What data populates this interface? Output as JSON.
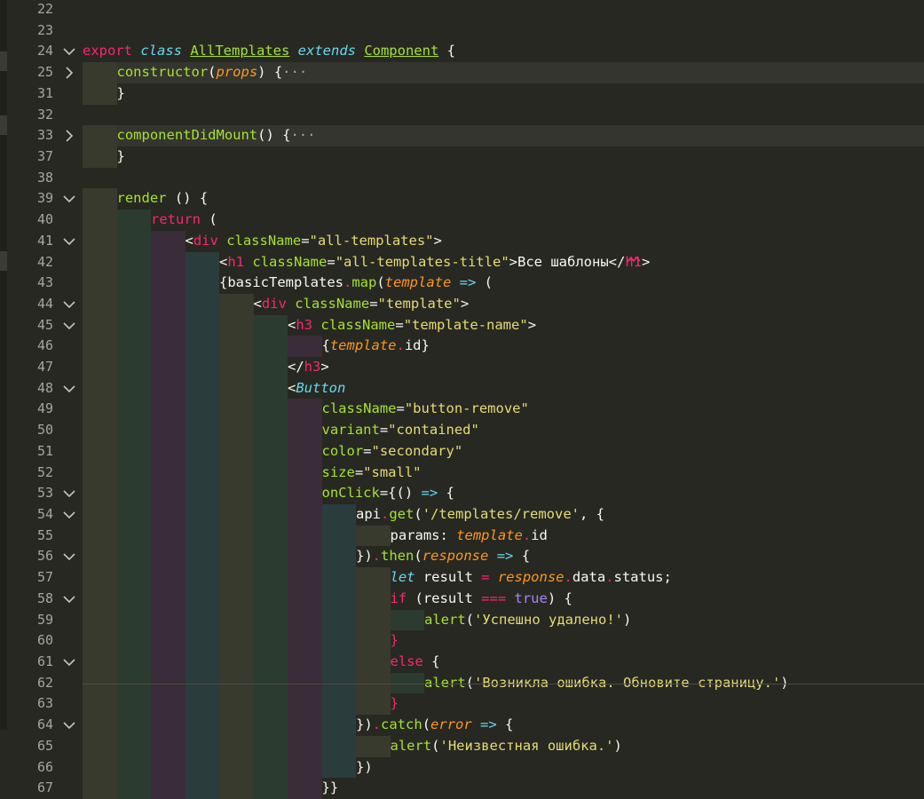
{
  "editor": {
    "colors": {
      "background": "#272822",
      "keyword": "#f92672",
      "storage": "#66d9ef",
      "class_name": "#a6e22e",
      "function": "#a6e22e",
      "string": "#e6db74",
      "parameter": "#fd971f",
      "attribute": "#a6e22e",
      "tag": "#f92672",
      "boolean": "#ae81ff",
      "plain": "#f8f8f2",
      "line_number": "#a6a69e"
    },
    "band_colors": [
      "#393a2e",
      "#2c3b30",
      "#3a2c38",
      "#2b3c3c"
    ],
    "lines": [
      {
        "n": "22",
        "fold": "",
        "depth": 0,
        "tokens": []
      },
      {
        "n": "23",
        "fold": "",
        "depth": 0,
        "tokens": []
      },
      {
        "n": "24",
        "fold": "open",
        "depth": 0,
        "tokens": [
          {
            "t": "export ",
            "c": "keyword"
          },
          {
            "t": "class ",
            "c": "storage",
            "i": true
          },
          {
            "t": "AllTemplates",
            "c": "class_name",
            "u": true
          },
          {
            "t": " "
          },
          {
            "t": "extends ",
            "c": "storage",
            "i": true
          },
          {
            "t": "Component",
            "c": "class_name",
            "u": true
          },
          {
            "t": " {"
          }
        ]
      },
      {
        "n": "25",
        "fold": "closed",
        "depth": 1,
        "hl": true,
        "tokens": [
          {
            "t": "constructor",
            "c": "function"
          },
          {
            "t": "("
          },
          {
            "t": "props",
            "c": "parameter",
            "i": true
          },
          {
            "t": ") {"
          },
          {
            "t": "···",
            "c": "line_number"
          }
        ]
      },
      {
        "n": "31",
        "fold": "",
        "depth": 1,
        "tokens": [
          {
            "t": "}"
          }
        ]
      },
      {
        "n": "32",
        "fold": "",
        "depth": 0,
        "tokens": []
      },
      {
        "n": "33",
        "fold": "closed",
        "depth": 1,
        "hl": true,
        "tokens": [
          {
            "t": "componentDidMount",
            "c": "function"
          },
          {
            "t": "() {"
          },
          {
            "t": "···",
            "c": "line_number"
          }
        ]
      },
      {
        "n": "37",
        "fold": "",
        "depth": 1,
        "tokens": [
          {
            "t": "}"
          }
        ]
      },
      {
        "n": "38",
        "fold": "",
        "depth": 0,
        "tokens": []
      },
      {
        "n": "39",
        "fold": "open",
        "depth": 1,
        "tokens": [
          {
            "t": "render",
            "c": "function"
          },
          {
            "t": " () {"
          }
        ]
      },
      {
        "n": "40",
        "fold": "",
        "depth": 2,
        "tokens": [
          {
            "t": "return",
            "c": "keyword"
          },
          {
            "t": " ("
          }
        ]
      },
      {
        "n": "41",
        "fold": "open",
        "depth": 3,
        "tokens": [
          {
            "t": "<"
          },
          {
            "t": "div",
            "c": "tag"
          },
          {
            "t": " "
          },
          {
            "t": "className",
            "c": "attribute"
          },
          {
            "t": "="
          },
          {
            "t": "\"all-templates\"",
            "c": "string"
          },
          {
            "t": ">"
          }
        ]
      },
      {
        "n": "42",
        "fold": "",
        "depth": 4,
        "tokens": [
          {
            "t": "<"
          },
          {
            "t": "h1",
            "c": "tag"
          },
          {
            "t": " "
          },
          {
            "t": "className",
            "c": "attribute"
          },
          {
            "t": "="
          },
          {
            "t": "\"all-templates-title\"",
            "c": "string"
          },
          {
            "t": ">Все шаблоны</"
          },
          {
            "t": "h1",
            "c": "tag"
          },
          {
            "t": ">"
          }
        ]
      },
      {
        "n": "43",
        "fold": "",
        "depth": 4,
        "tokens": [
          {
            "t": "{basicTemplates"
          },
          {
            "t": ".",
            "c": "keyword"
          },
          {
            "t": "map",
            "c": "function"
          },
          {
            "t": "("
          },
          {
            "t": "template",
            "c": "parameter",
            "i": true
          },
          {
            "t": " "
          },
          {
            "t": "=>",
            "c": "storage"
          },
          {
            "t": " ("
          }
        ]
      },
      {
        "n": "44",
        "fold": "open",
        "depth": 5,
        "tokens": [
          {
            "t": "<"
          },
          {
            "t": "div",
            "c": "tag"
          },
          {
            "t": " "
          },
          {
            "t": "className",
            "c": "attribute"
          },
          {
            "t": "="
          },
          {
            "t": "\"template\"",
            "c": "string"
          },
          {
            "t": ">"
          }
        ]
      },
      {
        "n": "45",
        "fold": "open",
        "depth": 6,
        "tokens": [
          {
            "t": "<"
          },
          {
            "t": "h3",
            "c": "tag"
          },
          {
            "t": " "
          },
          {
            "t": "className",
            "c": "attribute"
          },
          {
            "t": "="
          },
          {
            "t": "\"template-name\"",
            "c": "string"
          },
          {
            "t": ">"
          }
        ]
      },
      {
        "n": "46",
        "fold": "",
        "depth": 7,
        "tokens": [
          {
            "t": "{"
          },
          {
            "t": "template",
            "c": "parameter",
            "i": true
          },
          {
            "t": ".",
            "c": "keyword"
          },
          {
            "t": "id}"
          }
        ]
      },
      {
        "n": "47",
        "fold": "",
        "depth": 6,
        "tokens": [
          {
            "t": "</"
          },
          {
            "t": "h3",
            "c": "tag"
          },
          {
            "t": ">"
          }
        ]
      },
      {
        "n": "48",
        "fold": "open",
        "depth": 6,
        "tokens": [
          {
            "t": "<"
          },
          {
            "t": "Button",
            "c": "storage",
            "i": true
          }
        ]
      },
      {
        "n": "49",
        "fold": "",
        "depth": 7,
        "tokens": [
          {
            "t": "className",
            "c": "attribute"
          },
          {
            "t": "="
          },
          {
            "t": "\"button-remove\"",
            "c": "string"
          }
        ]
      },
      {
        "n": "50",
        "fold": "",
        "depth": 7,
        "tokens": [
          {
            "t": "variant",
            "c": "attribute"
          },
          {
            "t": "="
          },
          {
            "t": "\"contained\"",
            "c": "string"
          }
        ]
      },
      {
        "n": "51",
        "fold": "",
        "depth": 7,
        "tokens": [
          {
            "t": "color",
            "c": "attribute"
          },
          {
            "t": "="
          },
          {
            "t": "\"secondary\"",
            "c": "string"
          }
        ]
      },
      {
        "n": "52",
        "fold": "",
        "depth": 7,
        "tokens": [
          {
            "t": "size",
            "c": "attribute"
          },
          {
            "t": "="
          },
          {
            "t": "\"small\"",
            "c": "string"
          }
        ]
      },
      {
        "n": "53",
        "fold": "open",
        "depth": 7,
        "tokens": [
          {
            "t": "onClick",
            "c": "attribute"
          },
          {
            "t": "="
          },
          {
            "t": "{() "
          },
          {
            "t": "=>",
            "c": "storage"
          },
          {
            "t": " {"
          }
        ]
      },
      {
        "n": "54",
        "fold": "open",
        "depth": 8,
        "tokens": [
          {
            "t": "api"
          },
          {
            "t": ".",
            "c": "keyword"
          },
          {
            "t": "get",
            "c": "function"
          },
          {
            "t": "("
          },
          {
            "t": "'/templates/remove'",
            "c": "string"
          },
          {
            "t": ", {"
          }
        ]
      },
      {
        "n": "55",
        "fold": "",
        "depth": 9,
        "tokens": [
          {
            "t": "params: "
          },
          {
            "t": "template",
            "c": "parameter",
            "i": true
          },
          {
            "t": ".",
            "c": "keyword"
          },
          {
            "t": "id"
          }
        ]
      },
      {
        "n": "56",
        "fold": "open",
        "depth": 8,
        "tokens": [
          {
            "t": "})"
          },
          {
            "t": ".",
            "c": "keyword"
          },
          {
            "t": "then",
            "c": "function"
          },
          {
            "t": "("
          },
          {
            "t": "response",
            "c": "parameter",
            "i": true
          },
          {
            "t": " "
          },
          {
            "t": "=>",
            "c": "storage"
          },
          {
            "t": " {"
          }
        ]
      },
      {
        "n": "57",
        "fold": "",
        "depth": 9,
        "tokens": [
          {
            "t": "let",
            "c": "storage",
            "i": true
          },
          {
            "t": " result "
          },
          {
            "t": "=",
            "c": "keyword"
          },
          {
            "t": " "
          },
          {
            "t": "response",
            "c": "parameter",
            "i": true
          },
          {
            "t": ".",
            "c": "keyword"
          },
          {
            "t": "data"
          },
          {
            "t": ".",
            "c": "keyword"
          },
          {
            "t": "status;"
          }
        ]
      },
      {
        "n": "58",
        "fold": "open",
        "depth": 9,
        "tokens": [
          {
            "t": "if",
            "c": "keyword"
          },
          {
            "t": " (result "
          },
          {
            "t": "===",
            "c": "keyword"
          },
          {
            "t": " "
          },
          {
            "t": "true",
            "c": "boolean"
          },
          {
            "t": ") {"
          }
        ]
      },
      {
        "n": "59",
        "fold": "",
        "depth": 10,
        "tokens": [
          {
            "t": "alert",
            "c": "function"
          },
          {
            "t": "("
          },
          {
            "t": "'Успешно удалено!'",
            "c": "string"
          },
          {
            "t": ")"
          }
        ]
      },
      {
        "n": "60",
        "fold": "",
        "depth": 9,
        "tokens": [
          {
            "t": "}",
            "c": "keyword"
          }
        ]
      },
      {
        "n": "61",
        "fold": "open",
        "depth": 9,
        "tokens": [
          {
            "t": "else",
            "c": "keyword"
          },
          {
            "t": " {"
          }
        ]
      },
      {
        "n": "62",
        "fold": "",
        "depth": 10,
        "tokens": [
          {
            "t": "alert",
            "c": "function"
          },
          {
            "t": "("
          },
          {
            "t": "'Возникла ошибка. Обновите страницу.'",
            "c": "string"
          },
          {
            "t": ")"
          }
        ]
      },
      {
        "n": "63",
        "fold": "",
        "depth": 9,
        "tokens": [
          {
            "t": "}",
            "c": "keyword"
          }
        ]
      },
      {
        "n": "64",
        "fold": "open",
        "depth": 8,
        "tokens": [
          {
            "t": "})"
          },
          {
            "t": ".",
            "c": "keyword"
          },
          {
            "t": "catch",
            "c": "function"
          },
          {
            "t": "("
          },
          {
            "t": "error",
            "c": "parameter",
            "i": true
          },
          {
            "t": " "
          },
          {
            "t": "=>",
            "c": "storage"
          },
          {
            "t": " {"
          }
        ]
      },
      {
        "n": "65",
        "fold": "",
        "depth": 9,
        "tokens": [
          {
            "t": "alert",
            "c": "function"
          },
          {
            "t": "("
          },
          {
            "t": "'Неизвестная ошибка.'",
            "c": "string"
          },
          {
            "t": ")"
          }
        ]
      },
      {
        "n": "66",
        "fold": "",
        "depth": 8,
        "tokens": [
          {
            "t": "})"
          }
        ]
      },
      {
        "n": "67",
        "fold": "",
        "depth": 7,
        "tokens": [
          {
            "t": "}}"
          }
        ]
      }
    ]
  }
}
